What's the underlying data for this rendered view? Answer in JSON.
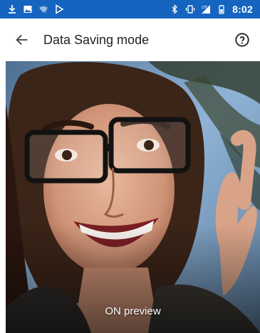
{
  "status_bar": {
    "time": "8:02",
    "left_icons": [
      "download-icon",
      "image-icon",
      "wifi-question-icon",
      "play-store-icon"
    ],
    "right_icons": [
      "bluetooth-icon",
      "vibrate-icon",
      "lte-signal-icon",
      "battery-icon"
    ],
    "background_color": "#1565c0"
  },
  "app_bar": {
    "title": "Data Saving mode",
    "back_icon": "arrow-back-icon",
    "help_icon": "help-circle-icon"
  },
  "preview": {
    "label": "ON preview"
  }
}
